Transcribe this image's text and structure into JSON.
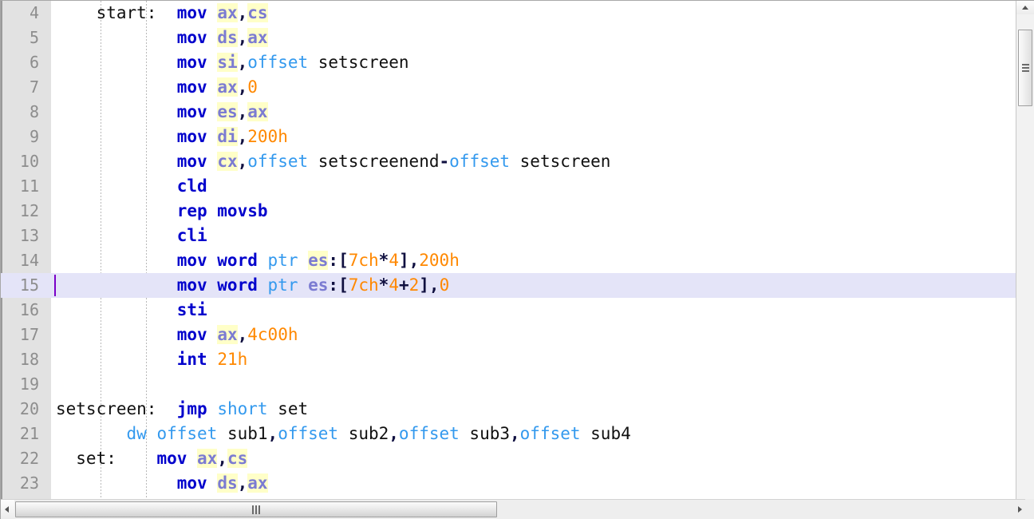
{
  "editor": {
    "language": "x86 Assembly",
    "first_visible_line": 4,
    "current_line": 15,
    "gutter": {
      "line_numbers": [
        "4",
        "5",
        "6",
        "7",
        "8",
        "9",
        "10",
        "11",
        "12",
        "13",
        "14",
        "15",
        "16",
        "17",
        "18",
        "19",
        "20",
        "21",
        "22",
        "23"
      ]
    },
    "colors": {
      "background": "#ffffff",
      "gutter_background": "#e2e2e2",
      "line_number": "#8d8d8d",
      "current_line_highlight": "#e4e4f8",
      "caret": "#7a00c8",
      "keyword": "#0000cc",
      "register": "#7b7bd2",
      "register_highlight_bg": "#ffffc8",
      "directive": "#3399ee",
      "number": "#ff8800",
      "punctuation": "#101040",
      "identifier": "#101010",
      "indent_guide": "#b9b9b9"
    },
    "lines": [
      {
        "n": "4",
        "current": false,
        "tokens": [
          {
            "t": "    start:  ",
            "c": "plain"
          },
          {
            "t": "mov",
            "c": "kw"
          },
          {
            "t": " ",
            "c": "plain"
          },
          {
            "t": "ax",
            "c": "reg"
          },
          {
            "t": ",",
            "c": "punc"
          },
          {
            "t": "cs",
            "c": "reg"
          }
        ]
      },
      {
        "n": "5",
        "current": false,
        "tokens": [
          {
            "t": "            ",
            "c": "plain"
          },
          {
            "t": "mov",
            "c": "kw"
          },
          {
            "t": " ",
            "c": "plain"
          },
          {
            "t": "ds",
            "c": "reg"
          },
          {
            "t": ",",
            "c": "punc"
          },
          {
            "t": "ax",
            "c": "reg"
          }
        ]
      },
      {
        "n": "6",
        "current": false,
        "tokens": [
          {
            "t": "            ",
            "c": "plain"
          },
          {
            "t": "mov",
            "c": "kw"
          },
          {
            "t": " ",
            "c": "plain"
          },
          {
            "t": "si",
            "c": "reg"
          },
          {
            "t": ",",
            "c": "punc"
          },
          {
            "t": "offset",
            "c": "dir"
          },
          {
            "t": " setscreen",
            "c": "plain"
          }
        ]
      },
      {
        "n": "7",
        "current": false,
        "tokens": [
          {
            "t": "            ",
            "c": "plain"
          },
          {
            "t": "mov",
            "c": "kw"
          },
          {
            "t": " ",
            "c": "plain"
          },
          {
            "t": "ax",
            "c": "reg"
          },
          {
            "t": ",",
            "c": "punc"
          },
          {
            "t": "0",
            "c": "num"
          }
        ]
      },
      {
        "n": "8",
        "current": false,
        "tokens": [
          {
            "t": "            ",
            "c": "plain"
          },
          {
            "t": "mov",
            "c": "kw"
          },
          {
            "t": " ",
            "c": "plain"
          },
          {
            "t": "es",
            "c": "reg"
          },
          {
            "t": ",",
            "c": "punc"
          },
          {
            "t": "ax",
            "c": "reg"
          }
        ]
      },
      {
        "n": "9",
        "current": false,
        "tokens": [
          {
            "t": "            ",
            "c": "plain"
          },
          {
            "t": "mov",
            "c": "kw"
          },
          {
            "t": " ",
            "c": "plain"
          },
          {
            "t": "di",
            "c": "reg"
          },
          {
            "t": ",",
            "c": "punc"
          },
          {
            "t": "200h",
            "c": "num"
          }
        ]
      },
      {
        "n": "10",
        "current": false,
        "tokens": [
          {
            "t": "            ",
            "c": "plain"
          },
          {
            "t": "mov",
            "c": "kw"
          },
          {
            "t": " ",
            "c": "plain"
          },
          {
            "t": "cx",
            "c": "reg"
          },
          {
            "t": ",",
            "c": "punc"
          },
          {
            "t": "offset",
            "c": "dir"
          },
          {
            "t": " setscreenend",
            "c": "plain"
          },
          {
            "t": "-",
            "c": "punc"
          },
          {
            "t": "offset",
            "c": "dir"
          },
          {
            "t": " setscreen",
            "c": "plain"
          }
        ]
      },
      {
        "n": "11",
        "current": false,
        "tokens": [
          {
            "t": "            ",
            "c": "plain"
          },
          {
            "t": "cld",
            "c": "kw"
          }
        ]
      },
      {
        "n": "12",
        "current": false,
        "tokens": [
          {
            "t": "            ",
            "c": "plain"
          },
          {
            "t": "rep movsb",
            "c": "kw"
          }
        ]
      },
      {
        "n": "13",
        "current": false,
        "tokens": [
          {
            "t": "            ",
            "c": "plain"
          },
          {
            "t": "cli",
            "c": "kw"
          }
        ]
      },
      {
        "n": "14",
        "current": false,
        "tokens": [
          {
            "t": "            ",
            "c": "plain"
          },
          {
            "t": "mov word",
            "c": "kw"
          },
          {
            "t": " ",
            "c": "plain"
          },
          {
            "t": "ptr",
            "c": "dir"
          },
          {
            "t": " ",
            "c": "plain"
          },
          {
            "t": "es",
            "c": "reg"
          },
          {
            "t": ":[",
            "c": "punc"
          },
          {
            "t": "7ch",
            "c": "num"
          },
          {
            "t": "*",
            "c": "punc"
          },
          {
            "t": "4",
            "c": "num"
          },
          {
            "t": "],",
            "c": "punc"
          },
          {
            "t": "200h",
            "c": "num"
          }
        ]
      },
      {
        "n": "15",
        "current": true,
        "tokens": [
          {
            "t": "            ",
            "c": "plain"
          },
          {
            "t": "mov word",
            "c": "kw"
          },
          {
            "t": " ",
            "c": "plain"
          },
          {
            "t": "ptr",
            "c": "dir"
          },
          {
            "t": " ",
            "c": "plain"
          },
          {
            "t": "es",
            "c": "reg-nb"
          },
          {
            "t": ":[",
            "c": "punc"
          },
          {
            "t": "7ch",
            "c": "num"
          },
          {
            "t": "*",
            "c": "punc"
          },
          {
            "t": "4",
            "c": "num"
          },
          {
            "t": "+",
            "c": "punc"
          },
          {
            "t": "2",
            "c": "num"
          },
          {
            "t": "],",
            "c": "punc"
          },
          {
            "t": "0",
            "c": "num"
          }
        ]
      },
      {
        "n": "16",
        "current": false,
        "tokens": [
          {
            "t": "            ",
            "c": "plain"
          },
          {
            "t": "sti",
            "c": "kw"
          }
        ]
      },
      {
        "n": "17",
        "current": false,
        "tokens": [
          {
            "t": "            ",
            "c": "plain"
          },
          {
            "t": "mov",
            "c": "kw"
          },
          {
            "t": " ",
            "c": "plain"
          },
          {
            "t": "ax",
            "c": "reg"
          },
          {
            "t": ",",
            "c": "punc"
          },
          {
            "t": "4c00h",
            "c": "num"
          }
        ]
      },
      {
        "n": "18",
        "current": false,
        "tokens": [
          {
            "t": "            ",
            "c": "plain"
          },
          {
            "t": "int",
            "c": "kw"
          },
          {
            "t": " ",
            "c": "plain"
          },
          {
            "t": "21h",
            "c": "num"
          }
        ]
      },
      {
        "n": "19",
        "current": false,
        "tokens": []
      },
      {
        "n": "20",
        "current": false,
        "tokens": [
          {
            "t": "setscreen:  ",
            "c": "plain"
          },
          {
            "t": "jmp",
            "c": "kw"
          },
          {
            "t": " ",
            "c": "plain"
          },
          {
            "t": "short",
            "c": "dir"
          },
          {
            "t": " set",
            "c": "plain"
          }
        ]
      },
      {
        "n": "21",
        "current": false,
        "tokens": [
          {
            "t": "       ",
            "c": "plain"
          },
          {
            "t": "dw offset",
            "c": "dir"
          },
          {
            "t": " sub1",
            "c": "plain"
          },
          {
            "t": ",",
            "c": "punc"
          },
          {
            "t": "offset",
            "c": "dir"
          },
          {
            "t": " sub2",
            "c": "plain"
          },
          {
            "t": ",",
            "c": "punc"
          },
          {
            "t": "offset",
            "c": "dir"
          },
          {
            "t": " sub3",
            "c": "plain"
          },
          {
            "t": ",",
            "c": "punc"
          },
          {
            "t": "offset",
            "c": "dir"
          },
          {
            "t": " sub4",
            "c": "plain"
          }
        ]
      },
      {
        "n": "22",
        "current": false,
        "tokens": [
          {
            "t": "  set:    ",
            "c": "plain"
          },
          {
            "t": "mov",
            "c": "kw"
          },
          {
            "t": " ",
            "c": "plain"
          },
          {
            "t": "ax",
            "c": "reg"
          },
          {
            "t": ",",
            "c": "punc"
          },
          {
            "t": "cs",
            "c": "reg"
          }
        ]
      },
      {
        "n": "23",
        "current": false,
        "tokens": [
          {
            "t": "            ",
            "c": "plain"
          },
          {
            "t": "mov",
            "c": "kw"
          },
          {
            "t": " ",
            "c": "plain"
          },
          {
            "t": "ds",
            "c": "reg"
          },
          {
            "t": ",",
            "c": "punc"
          },
          {
            "t": "ax",
            "c": "reg"
          }
        ]
      }
    ]
  },
  "scrollbars": {
    "vertical": {
      "up_arrow": "scroll-up-arrow",
      "thumb_top_pct": 6,
      "thumb_height_pct": 15
    },
    "horizontal": {
      "left_arrow": "scroll-left-arrow",
      "right_arrow": "scroll-right-arrow",
      "thumb_left_pct": 1,
      "thumb_width_pct": 48
    }
  }
}
